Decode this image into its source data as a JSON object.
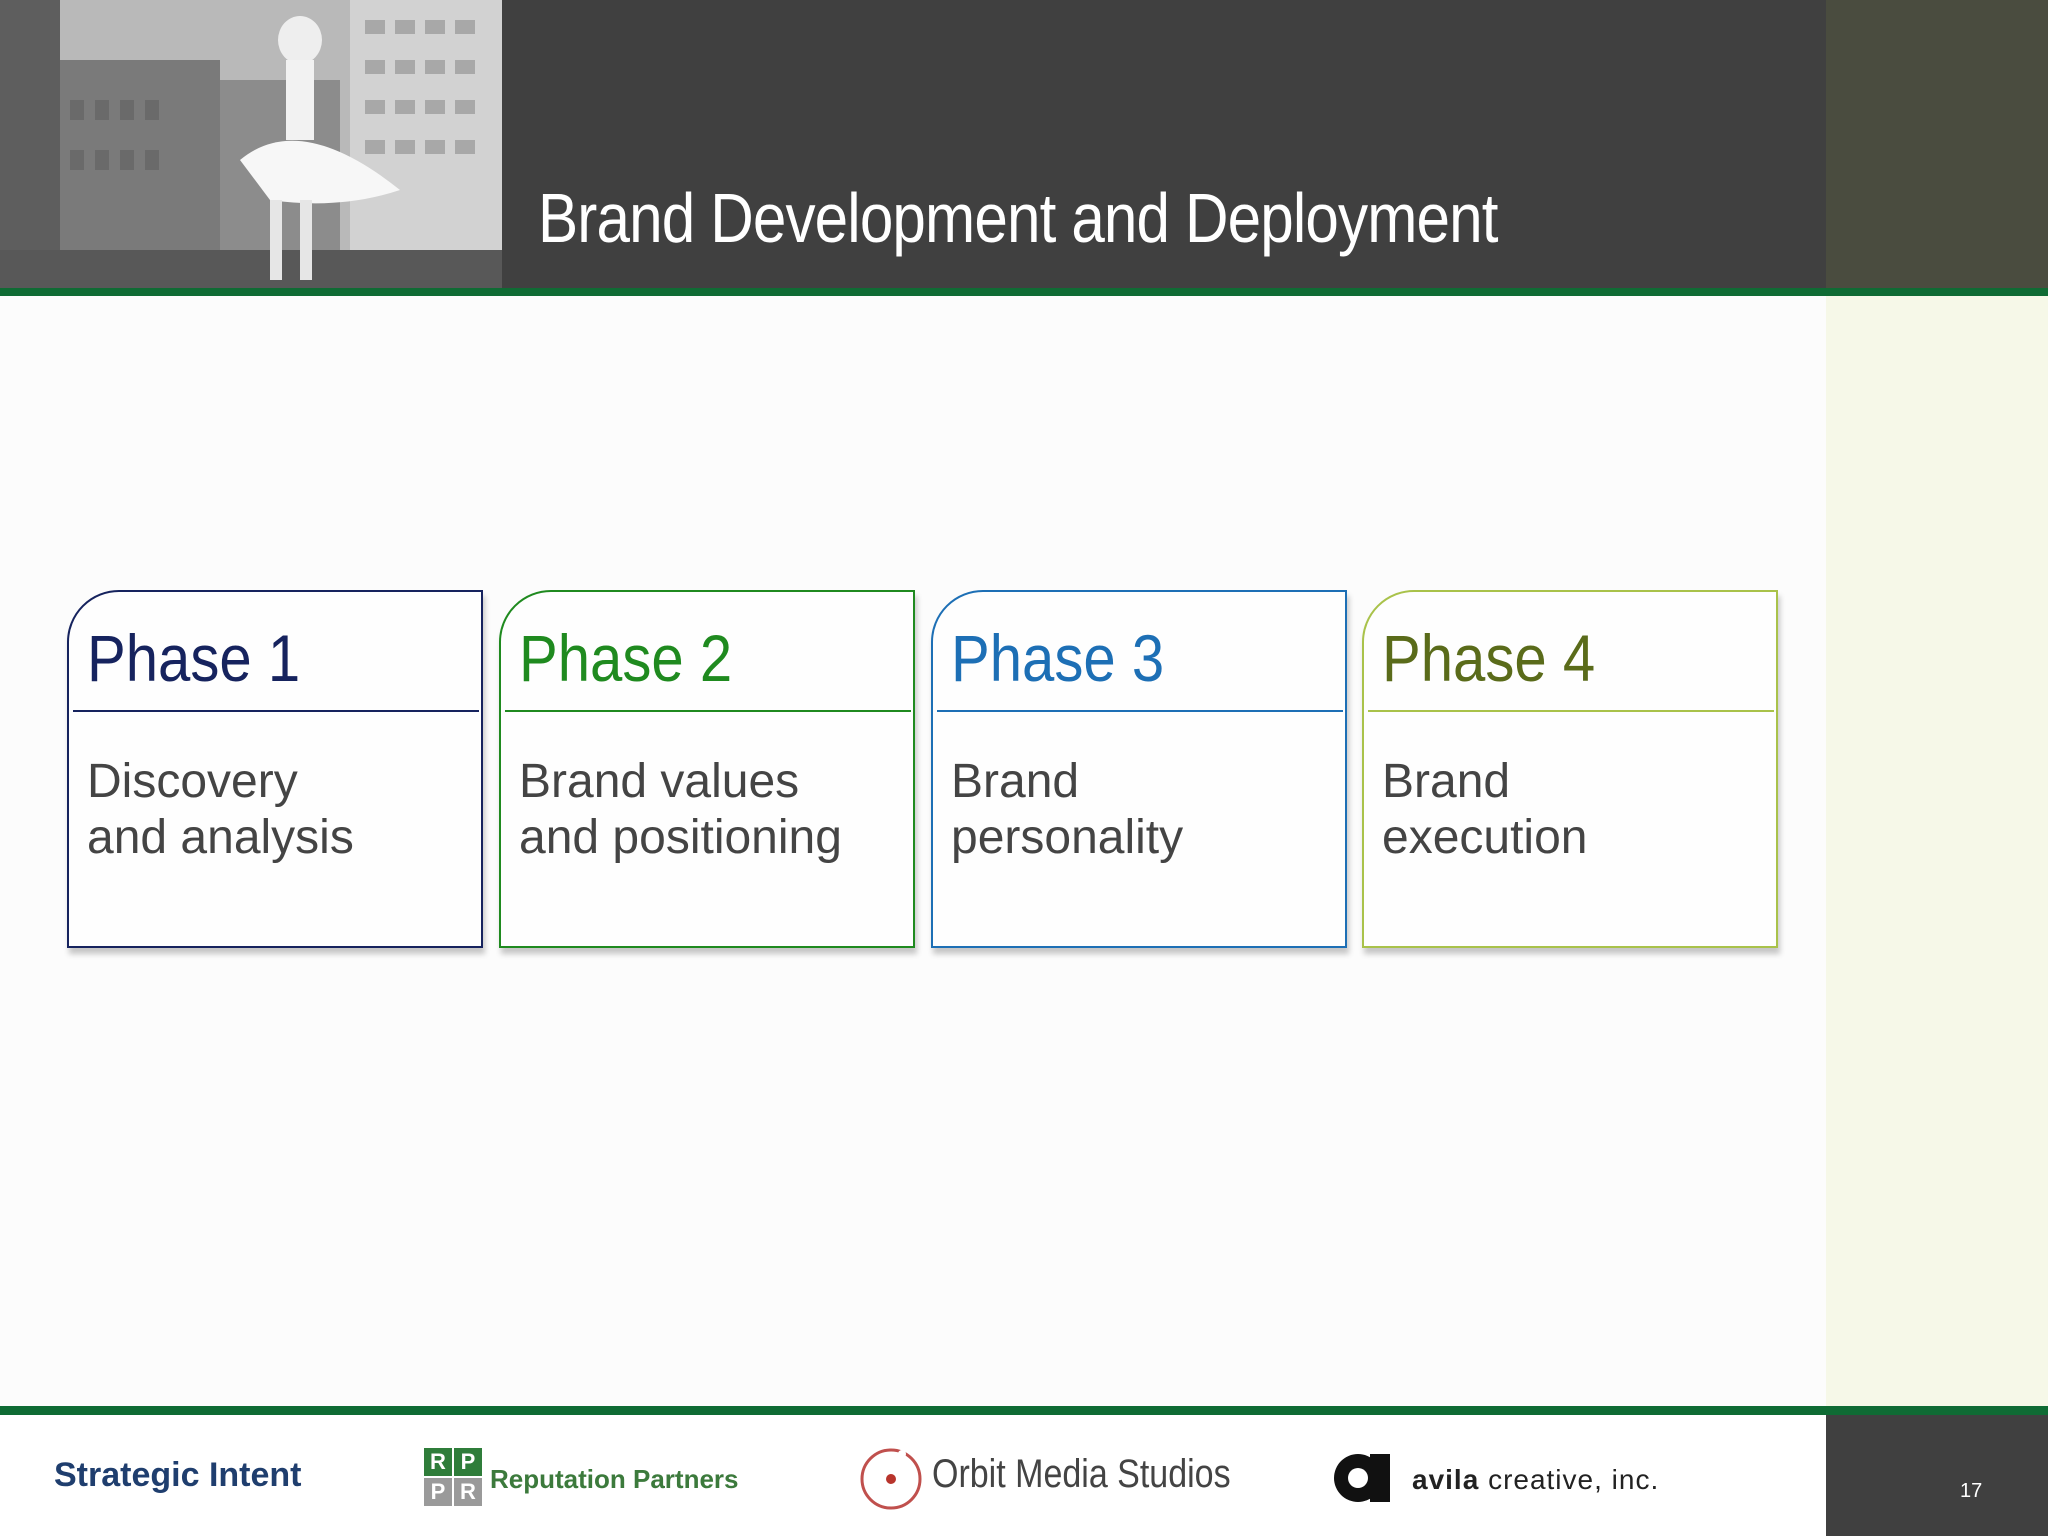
{
  "slide": {
    "title": "Brand Development and Deployment",
    "page_number": "17"
  },
  "phases": [
    {
      "title": "Phase 1",
      "desc_lines": [
        "Discovery",
        "and analysis"
      ],
      "color": "#16235e"
    },
    {
      "title": "Phase 2",
      "desc_lines": [
        "Brand values",
        "and positioning"
      ],
      "color": "#1f8a1f"
    },
    {
      "title": "Phase 3",
      "desc_lines": [
        "Brand",
        "personality"
      ],
      "color": "#1d6fb5"
    },
    {
      "title": "Phase 4",
      "desc_lines": [
        "Brand",
        "execution"
      ],
      "color": "#5a6b1a",
      "border_color": "#a9c24a"
    }
  ],
  "footer": {
    "strategic_intent": "Strategic Intent",
    "reputation_partners": {
      "letters": [
        "R",
        "P",
        "P",
        "R"
      ],
      "name": "Reputation Partners"
    },
    "orbit_media": "Orbit Media Studios",
    "avila": {
      "brand": "avila",
      "suffix": "creative, inc."
    }
  },
  "colors": {
    "header_bg": "#404040",
    "accent_green": "#0f6b34",
    "side_band": "#f6f8e8"
  }
}
